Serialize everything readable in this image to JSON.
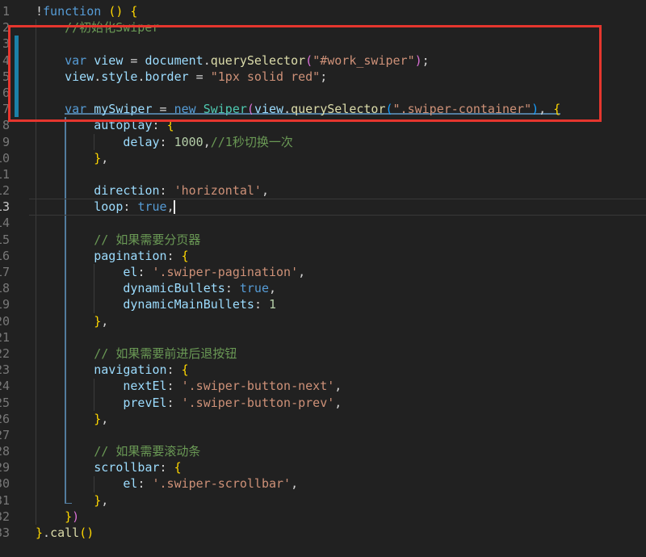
{
  "editor": {
    "line_count": 33,
    "active_line": 13,
    "cursor": {
      "line": 13,
      "after_text": "        loop: true,"
    },
    "lines": [
      [
        [
          "!",
          "pun"
        ],
        [
          "function",
          "kw"
        ],
        [
          " ",
          "pun"
        ],
        [
          "()",
          "b1"
        ],
        [
          " ",
          "pun"
        ],
        [
          "{",
          "b1"
        ]
      ],
      [
        [
          "    ",
          "pun"
        ],
        [
          "//初始化Swiper",
          "cmt"
        ]
      ],
      [],
      [
        [
          "    ",
          "pun"
        ],
        [
          "var",
          "kw"
        ],
        [
          " ",
          "pun"
        ],
        [
          "view",
          "var"
        ],
        [
          " = ",
          "pun"
        ],
        [
          "document",
          "var"
        ],
        [
          ".",
          "pun"
        ],
        [
          "querySelector",
          "fn"
        ],
        [
          "(",
          "b2"
        ],
        [
          "\"#work_swiper\"",
          "str"
        ],
        [
          ")",
          "b2"
        ],
        [
          ";",
          "pun"
        ]
      ],
      [
        [
          "    ",
          "pun"
        ],
        [
          "view",
          "var"
        ],
        [
          ".",
          "pun"
        ],
        [
          "style",
          "var"
        ],
        [
          ".",
          "pun"
        ],
        [
          "border",
          "var"
        ],
        [
          " = ",
          "pun"
        ],
        [
          "\"1px solid red\"",
          "str"
        ],
        [
          ";",
          "pun"
        ]
      ],
      [],
      [
        [
          "    ",
          "pun"
        ],
        [
          "var",
          "kw"
        ],
        [
          " ",
          "pun"
        ],
        [
          "mySwiper",
          "var"
        ],
        [
          " = ",
          "pun"
        ],
        [
          "new",
          "kw"
        ],
        [
          " ",
          "pun"
        ],
        [
          "Swiper",
          "cls"
        ],
        [
          "(",
          "b2"
        ],
        [
          "view",
          "var"
        ],
        [
          ".",
          "pun"
        ],
        [
          "querySelector",
          "fn"
        ],
        [
          "(",
          "b3"
        ],
        [
          "\".swiper-container\"",
          "str"
        ],
        [
          ")",
          "b3"
        ],
        [
          ", ",
          "pun"
        ],
        [
          "{",
          "b1"
        ]
      ],
      [
        [
          "        ",
          "pun"
        ],
        [
          "autoplay",
          "var"
        ],
        [
          ": ",
          "pun"
        ],
        [
          "{",
          "b1"
        ]
      ],
      [
        [
          "            ",
          "pun"
        ],
        [
          "delay",
          "var"
        ],
        [
          ": ",
          "pun"
        ],
        [
          "1000",
          "num"
        ],
        [
          ",",
          "pun"
        ],
        [
          "//1秒切换一次",
          "cmt"
        ]
      ],
      [
        [
          "        ",
          "pun"
        ],
        [
          "}",
          "b1"
        ],
        [
          ",",
          "pun"
        ]
      ],
      [],
      [
        [
          "        ",
          "pun"
        ],
        [
          "direction",
          "var"
        ],
        [
          ": ",
          "pun"
        ],
        [
          "'horizontal'",
          "str"
        ],
        [
          ",",
          "pun"
        ]
      ],
      [
        [
          "        ",
          "pun"
        ],
        [
          "loop",
          "var"
        ],
        [
          ": ",
          "pun"
        ],
        [
          "true",
          "kw"
        ],
        [
          ",",
          "pun"
        ]
      ],
      [],
      [
        [
          "        ",
          "pun"
        ],
        [
          "// 如果需要分页器",
          "cmt"
        ]
      ],
      [
        [
          "        ",
          "pun"
        ],
        [
          "pagination",
          "var"
        ],
        [
          ": ",
          "pun"
        ],
        [
          "{",
          "b1"
        ]
      ],
      [
        [
          "            ",
          "pun"
        ],
        [
          "el",
          "var"
        ],
        [
          ": ",
          "pun"
        ],
        [
          "'.swiper-pagination'",
          "str"
        ],
        [
          ",",
          "pun"
        ]
      ],
      [
        [
          "            ",
          "pun"
        ],
        [
          "dynamicBullets",
          "var"
        ],
        [
          ": ",
          "pun"
        ],
        [
          "true",
          "kw"
        ],
        [
          ",",
          "pun"
        ]
      ],
      [
        [
          "            ",
          "pun"
        ],
        [
          "dynamicMainBullets",
          "var"
        ],
        [
          ": ",
          "pun"
        ],
        [
          "1",
          "num"
        ]
      ],
      [
        [
          "        ",
          "pun"
        ],
        [
          "}",
          "b1"
        ],
        [
          ",",
          "pun"
        ]
      ],
      [],
      [
        [
          "        ",
          "pun"
        ],
        [
          "// 如果需要前进后退按钮",
          "cmt"
        ]
      ],
      [
        [
          "        ",
          "pun"
        ],
        [
          "navigation",
          "var"
        ],
        [
          ": ",
          "pun"
        ],
        [
          "{",
          "b1"
        ]
      ],
      [
        [
          "            ",
          "pun"
        ],
        [
          "nextEl",
          "var"
        ],
        [
          ": ",
          "pun"
        ],
        [
          "'.swiper-button-next'",
          "str"
        ],
        [
          ",",
          "pun"
        ]
      ],
      [
        [
          "            ",
          "pun"
        ],
        [
          "prevEl",
          "var"
        ],
        [
          ": ",
          "pun"
        ],
        [
          "'.swiper-button-prev'",
          "str"
        ],
        [
          ",",
          "pun"
        ]
      ],
      [
        [
          "        ",
          "pun"
        ],
        [
          "}",
          "b1"
        ],
        [
          ",",
          "pun"
        ]
      ],
      [],
      [
        [
          "        ",
          "pun"
        ],
        [
          "// 如果需要滚动条",
          "cmt"
        ]
      ],
      [
        [
          "        ",
          "pun"
        ],
        [
          "scrollbar",
          "var"
        ],
        [
          ": ",
          "pun"
        ],
        [
          "{",
          "b1"
        ]
      ],
      [
        [
          "            ",
          "pun"
        ],
        [
          "el",
          "var"
        ],
        [
          ": ",
          "pun"
        ],
        [
          "'.swiper-scrollbar'",
          "str"
        ],
        [
          ",",
          "pun"
        ]
      ],
      [
        [
          "        ",
          "pun"
        ],
        [
          "}",
          "b1"
        ],
        [
          ",",
          "pun"
        ]
      ],
      [
        [
          "    ",
          "pun"
        ],
        [
          "}",
          "b1"
        ],
        [
          ")",
          "b2"
        ]
      ],
      [
        [
          "}",
          "b1"
        ],
        [
          ".",
          "pun"
        ],
        [
          "call",
          "fn"
        ],
        [
          "()",
          "b1"
        ]
      ]
    ]
  },
  "gutter": {
    "modified_lines_indicator": {
      "from_line": 3,
      "to_line": 7,
      "color": "#1B81A8"
    }
  },
  "annotation_box": {
    "shape": "red-rectangle",
    "color": "#E5362E",
    "covers_lines": "2-8"
  },
  "colors": {
    "background": "#212121",
    "active_bracket_guide": "#527C9E",
    "indent_guide": "#3b3b3b",
    "line_number": "#787878",
    "active_line_number": "#c8c8c8",
    "syntax": {
      "kw": "#569CD6",
      "var": "#9CDCFE",
      "fn": "#DCDCAA",
      "cls": "#4EC9B0",
      "str": "#CE9178",
      "num": "#B5CEA8",
      "cmt": "#6A9955",
      "pun": "#D4D4D4",
      "b1": "#FFD700",
      "b2": "#DA70D6",
      "b3": "#179FFF"
    }
  }
}
